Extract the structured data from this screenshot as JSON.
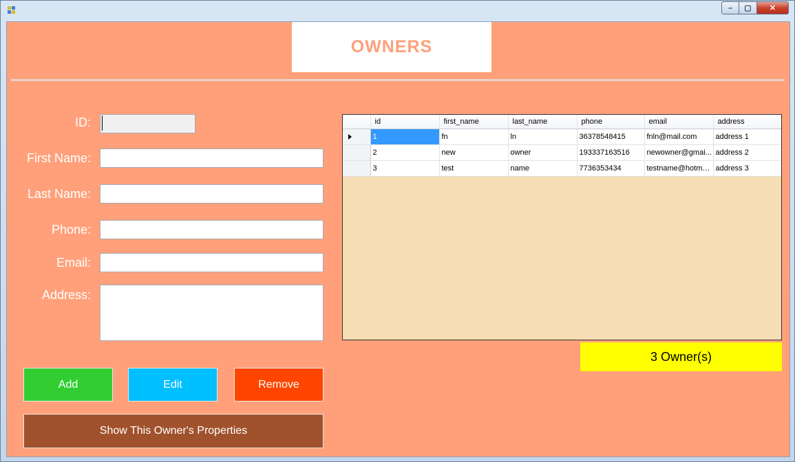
{
  "window": {
    "min_glyph": "–",
    "max_glyph": "▢",
    "close_glyph": "✕"
  },
  "header": {
    "title": "OWNERS"
  },
  "form": {
    "id_label": "ID:",
    "first_name_label": "First Name:",
    "last_name_label": "Last Name:",
    "phone_label": "Phone:",
    "email_label": "Email:",
    "address_label": "Address:",
    "id_value": "",
    "first_name_value": "",
    "last_name_value": "",
    "phone_value": "",
    "email_value": "",
    "address_value": ""
  },
  "buttons": {
    "add": "Add",
    "edit": "Edit",
    "remove": "Remove",
    "show_properties": "Show This Owner's Properties"
  },
  "grid": {
    "columns": [
      "id",
      "first_name",
      "last_name",
      "phone",
      "email",
      "address"
    ],
    "rows": [
      [
        "1",
        "fn",
        "ln",
        "36378548415",
        "fnln@mail.com",
        "address 1"
      ],
      [
        "2",
        "new",
        "owner",
        "193337163516",
        "newowner@gmai...",
        "address 2"
      ],
      [
        "3",
        "test",
        "name",
        "7736353434",
        "testname@hotma...",
        "address 3"
      ]
    ],
    "selected_row": 0
  },
  "status": {
    "count_text": "3 Owner(s)"
  },
  "colors": {
    "background": "#ffa07a",
    "add": "#32cd32",
    "edit": "#00bfff",
    "remove": "#ff4500",
    "show": "#a0522d",
    "grid_background": "#f5deb3",
    "count_background": "#ffff00"
  }
}
